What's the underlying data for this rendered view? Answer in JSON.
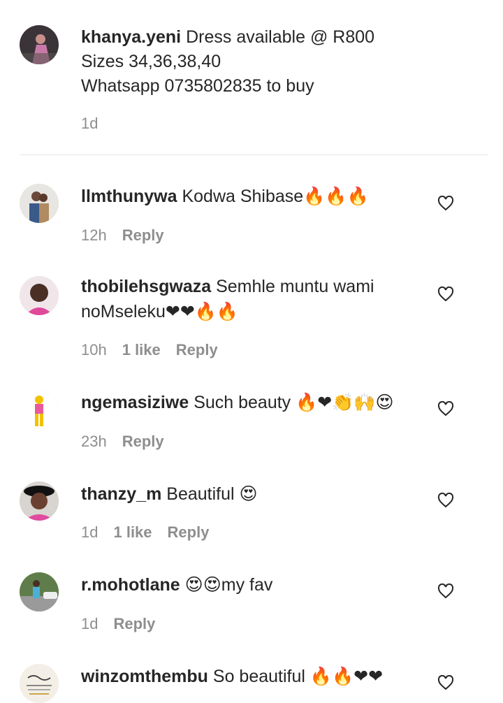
{
  "caption": {
    "username": "khanya.yeni",
    "lines": [
      "Dress available @ R800",
      "Sizes 34,36,38,40",
      "Whatsapp 0735802835 to buy"
    ],
    "time": "1d"
  },
  "comments": [
    {
      "username": "llmthunywa",
      "text": "Kodwa Shibase",
      "emoji": "🔥🔥🔥",
      "time": "12h",
      "likes": "",
      "reply": "Reply"
    },
    {
      "username": "thobilehsgwaza",
      "text": "Semhle muntu wami",
      "text2": "noMseleku",
      "emoji": "❤❤🔥🔥",
      "time": "10h",
      "likes": "1 like",
      "reply": "Reply"
    },
    {
      "username": "ngemasiziwe",
      "text": "Such beauty",
      "emoji": "🔥❤👏🙌😍",
      "time": "23h",
      "likes": "",
      "reply": "Reply"
    },
    {
      "username": "thanzy_m",
      "text": "Beautiful",
      "emoji": "😍",
      "time": "1d",
      "likes": "1 like",
      "reply": "Reply"
    },
    {
      "username": "r.mohotlane",
      "text": "my fav",
      "emoji": "😍😍",
      "time": "1d",
      "likes": "",
      "reply": "Reply"
    },
    {
      "username": "winzomthembu",
      "text": "So beautiful",
      "emoji": "🔥🔥❤❤",
      "time": "",
      "likes": "",
      "reply": ""
    }
  ],
  "colors": {
    "text": "#262626",
    "meta": "#8e8e8e",
    "divider": "#e6e6e6",
    "heart": "#262626"
  }
}
